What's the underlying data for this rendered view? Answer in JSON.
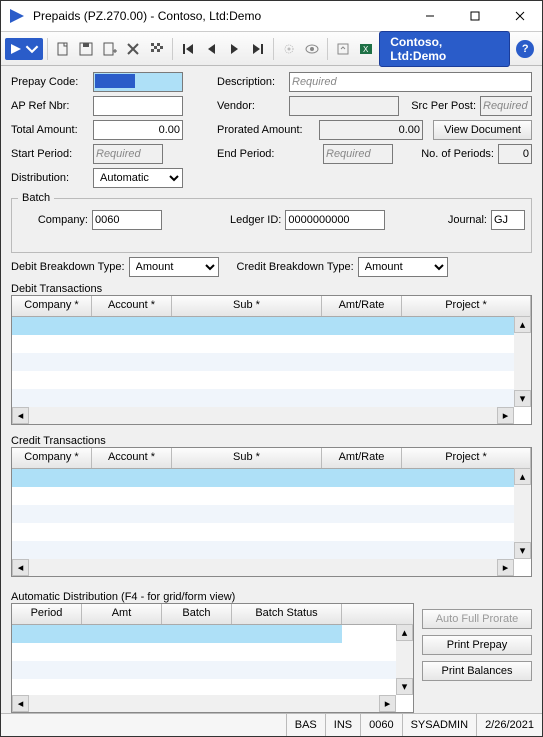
{
  "window": {
    "title": "Prepaids (PZ.270.00) - Contoso, Ltd:Demo"
  },
  "brand": {
    "label": "Contoso, Ltd:Demo",
    "help": "?"
  },
  "toolbar": {
    "icons": [
      "new",
      "save",
      "save-template",
      "delete",
      "checkered-flag",
      "first",
      "prev",
      "next",
      "last",
      "target",
      "eye",
      "export",
      "excel"
    ]
  },
  "form": {
    "prepay_code": {
      "label": "Prepay Code:",
      "value": "",
      "highlighted": true
    },
    "ap_ref_nbr": {
      "label": "AP Ref Nbr:",
      "value": ""
    },
    "total_amount": {
      "label": "Total Amount:",
      "value": "0.00"
    },
    "start_period": {
      "label": "Start Period:",
      "placeholder": "Required"
    },
    "distribution": {
      "label": "Distribution:",
      "value": "Automatic",
      "options": [
        "Automatic"
      ]
    },
    "description": {
      "label": "Description:",
      "placeholder": "Required"
    },
    "vendor": {
      "label": "Vendor:",
      "value": ""
    },
    "src_per_post": {
      "label": "Src Per Post:",
      "placeholder": "Required"
    },
    "prorated_amount": {
      "label": "Prorated Amount:",
      "value": "0.00"
    },
    "view_document": "View Document",
    "end_period": {
      "label": "End Period:",
      "placeholder": "Required"
    },
    "no_of_periods": {
      "label": "No. of Periods:",
      "value": "0"
    }
  },
  "batch": {
    "legend": "Batch",
    "company": {
      "label": "Company:",
      "value": "0060"
    },
    "ledger_id": {
      "label": "Ledger ID:",
      "value": "0000000000"
    },
    "journal": {
      "label": "Journal:",
      "value": "GJ"
    }
  },
  "breakdown": {
    "debit": {
      "label": "Debit Breakdown Type:",
      "value": "Amount",
      "options": [
        "Amount"
      ]
    },
    "credit": {
      "label": "Credit Breakdown Type:",
      "value": "Amount",
      "options": [
        "Amount"
      ]
    }
  },
  "debit_grid": {
    "title": "Debit Transactions",
    "columns": [
      "Company *",
      "Account *",
      "Sub *",
      "Amt/Rate",
      "Project *"
    ]
  },
  "credit_grid": {
    "title": "Credit Transactions",
    "columns": [
      "Company *",
      "Account *",
      "Sub *",
      "Amt/Rate",
      "Project *"
    ]
  },
  "auto_dist": {
    "title": "Automatic Distribution (F4 - for grid/form view)",
    "columns": [
      "Period",
      "Amt",
      "Batch",
      "Batch Status"
    ]
  },
  "buttons": {
    "auto_full_prorate": "Auto Full Prorate",
    "print_prepay": "Print Prepay",
    "print_balances": "Print Balances"
  },
  "status": {
    "mode1": "BAS",
    "mode2": "INS",
    "company": "0060",
    "user": "SYSADMIN",
    "date": "2/26/2021"
  }
}
